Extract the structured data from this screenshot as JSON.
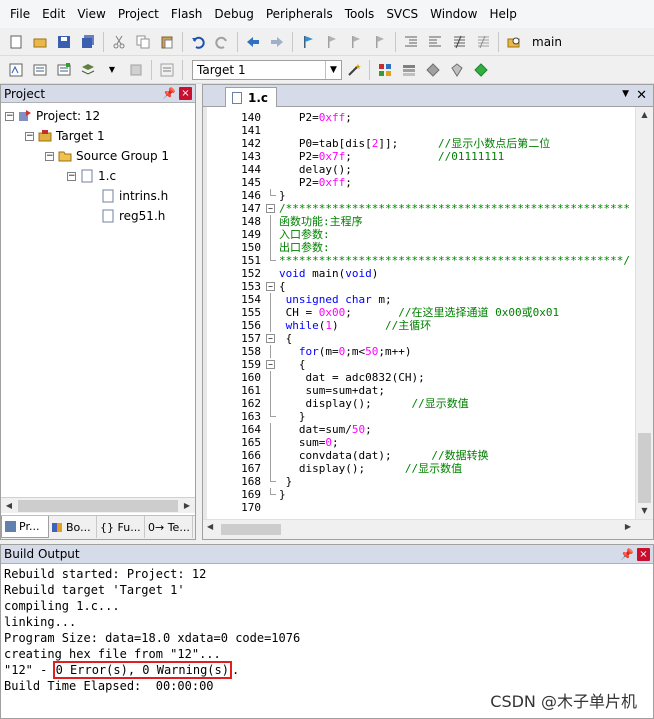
{
  "menu": [
    "File",
    "Edit",
    "View",
    "Project",
    "Flash",
    "Debug",
    "Peripherals",
    "Tools",
    "SVCS",
    "Window",
    "Help"
  ],
  "toolbar": {
    "target_label": "main",
    "target_select": "Target 1"
  },
  "project_pane": {
    "title": "Project",
    "tree": {
      "project": "Project: 12",
      "target": "Target 1",
      "group": "Source Group 1",
      "file": "1.c",
      "headers": [
        "intrins.h",
        "reg51.h"
      ]
    },
    "tabs": [
      "Pr...",
      "Bo...",
      "{} Fu...",
      "0→ Te..."
    ]
  },
  "editor": {
    "tab": "1.c",
    "lines": [
      {
        "n": "140",
        "t": "   P2=0xff;"
      },
      {
        "n": "141",
        "t": ""
      },
      {
        "n": "142",
        "t": "   P0=tab[dis[2]];      //显示小数点后第二位"
      },
      {
        "n": "143",
        "t": "   P2=0x7f;             //01111111"
      },
      {
        "n": "144",
        "t": "   delay();"
      },
      {
        "n": "145",
        "t": "   P2=0xff;"
      },
      {
        "n": "146",
        "t": "}"
      },
      {
        "n": "147",
        "t": "/****************************************************"
      },
      {
        "n": "148",
        "t": "函数功能:主程序"
      },
      {
        "n": "149",
        "t": "入口参数:"
      },
      {
        "n": "150",
        "t": "出口参数:"
      },
      {
        "n": "151",
        "t": "****************************************************/"
      },
      {
        "n": "152",
        "t": "void main(void)"
      },
      {
        "n": "153",
        "t": "{"
      },
      {
        "n": "154",
        "t": " unsigned char m;"
      },
      {
        "n": "155",
        "t": " CH = 0x00;       //在这里选择通道 0x00或0x01"
      },
      {
        "n": "156",
        "t": " while(1)       //主循环"
      },
      {
        "n": "157",
        "t": " {"
      },
      {
        "n": "158",
        "t": "   for(m=0;m<50;m++)"
      },
      {
        "n": "159",
        "t": "   {"
      },
      {
        "n": "160",
        "t": "    dat = adc0832(CH);"
      },
      {
        "n": "161",
        "t": "    sum=sum+dat;"
      },
      {
        "n": "162",
        "t": "    display();      //显示数值"
      },
      {
        "n": "163",
        "t": "   }"
      },
      {
        "n": "164",
        "t": "   dat=sum/50;"
      },
      {
        "n": "165",
        "t": "   sum=0;"
      },
      {
        "n": "166",
        "t": "   convdata(dat);      //数据转换"
      },
      {
        "n": "167",
        "t": "   display();      //显示数值"
      },
      {
        "n": "168",
        "t": " }"
      },
      {
        "n": "169",
        "t": "}"
      },
      {
        "n": "170",
        "t": ""
      }
    ]
  },
  "build_output": {
    "title": "Build Output",
    "lines": [
      "Rebuild started: Project: 12",
      "Rebuild target 'Target 1'",
      "compiling 1.c...",
      "linking...",
      "Program Size: data=18.0 xdata=0 code=1076",
      "creating hex file from \"12\"..."
    ],
    "result_prefix": "\"12\" - ",
    "result_highlight": "0 Error(s), 0 Warning(s)",
    "result_suffix": ".",
    "elapsed": "Build Time Elapsed:  00:00:00"
  },
  "watermark": "CSDN @木子单片机",
  "colors": {
    "keyword": "#0000ff",
    "number": "#ff00ff",
    "comment": "#008000",
    "highlight_box": "#e02020"
  }
}
